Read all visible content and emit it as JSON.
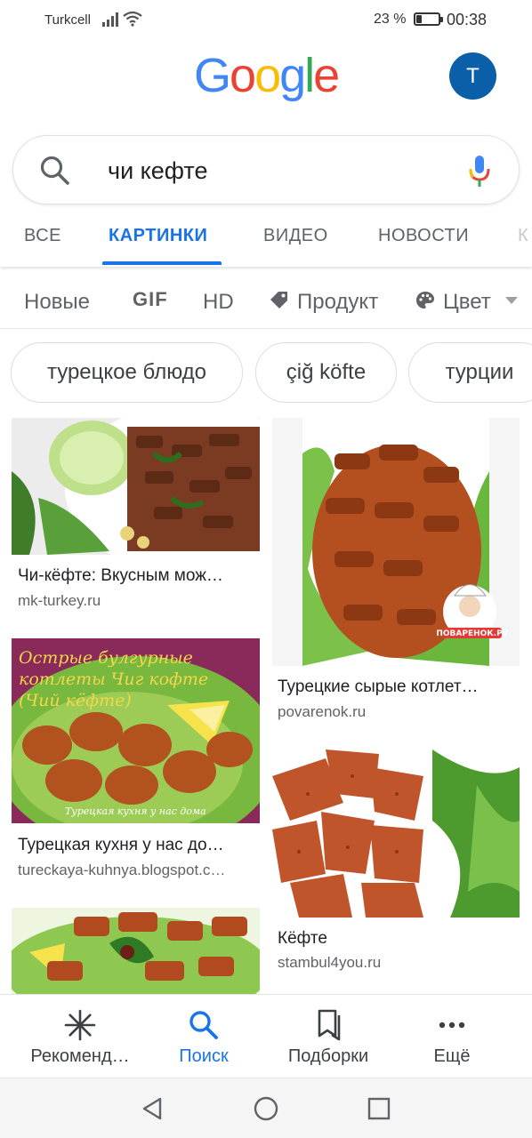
{
  "status_bar": {
    "carrier": "Turkcell",
    "battery_pct": "23 %",
    "battery_level": 0.23,
    "time": "00:38"
  },
  "header": {
    "logo_letters": [
      "G",
      "o",
      "o",
      "g",
      "l",
      "e"
    ],
    "avatar_initial": "T"
  },
  "search": {
    "query": "чи кефте"
  },
  "tabs": [
    {
      "label": "ВСЕ",
      "active": false
    },
    {
      "label": "КАРТИНКИ",
      "active": true
    },
    {
      "label": "ВИДЕО",
      "active": false
    },
    {
      "label": "НОВОСТИ",
      "active": false
    },
    {
      "label": "К",
      "active": false
    }
  ],
  "filters": {
    "new": "Новые",
    "gif": "GIF",
    "hd": "HD",
    "product": "Продукт",
    "color": "Цвет"
  },
  "chips": [
    "турецкое блюдо",
    "çiğ köfte",
    "турции"
  ],
  "results": [
    {
      "title": "Чи-кёфте: Вкусным мож…",
      "source": "mk-turkey.ru"
    },
    {
      "title": "Турецкие сырые котлет…",
      "source": "povarenok.ru",
      "watermark": "ПОВАРЕНОК.РУ"
    },
    {
      "title": "Турецкая кухня у нас до…",
      "source": "tureckaya-kuhnya.blogspot.c…",
      "overlay_text": "Острые булгурные котлеты Чиг кофте (Чий кёфте)",
      "caption": "Турецкая кухня у нас дома"
    },
    {
      "title": "Кёфте",
      "source": "stambul4you.ru"
    }
  ],
  "bottom_nav": [
    {
      "label": "Рекоменд…",
      "icon": "asterisk-icon",
      "active": false
    },
    {
      "label": "Поиск",
      "icon": "search-icon",
      "active": true
    },
    {
      "label": "Подборки",
      "icon": "collections-icon",
      "active": false
    },
    {
      "label": "Ещё",
      "icon": "more-icon",
      "active": false
    }
  ],
  "system_nav": {
    "back": "back-icon",
    "home": "home-icon",
    "recents": "recents-icon"
  },
  "colors": {
    "accent": "#1a73e8",
    "avatar": "#0b5fa8",
    "google_blue": "#4285F4",
    "google_red": "#EA4335",
    "google_yellow": "#FBBC05",
    "google_green": "#34A853"
  }
}
